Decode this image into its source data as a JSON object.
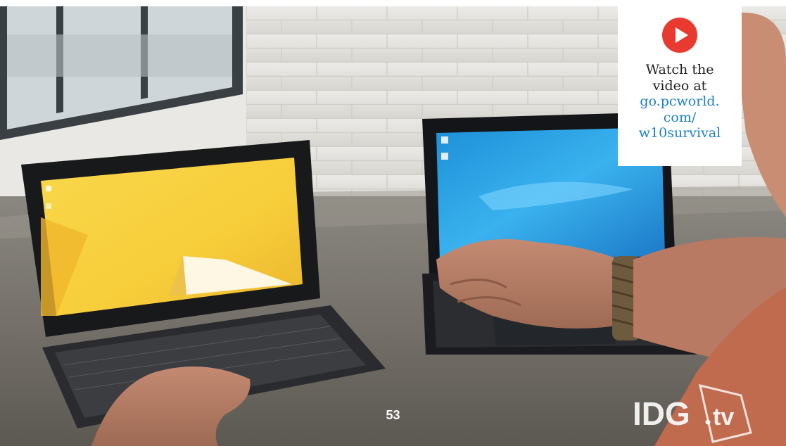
{
  "video_card": {
    "icon": "play-button-icon",
    "text_line1": "Watch the",
    "text_line2": "video at",
    "link_line1": "go.pcworld.",
    "link_line2": "com/",
    "link_line3": "w10survival",
    "icon_color": "#e83a2f",
    "link_color": "#1e7fc8"
  },
  "page_number": "53",
  "watermark": {
    "logo": "IDG.tv",
    "icon": "idg-tv-logo"
  }
}
